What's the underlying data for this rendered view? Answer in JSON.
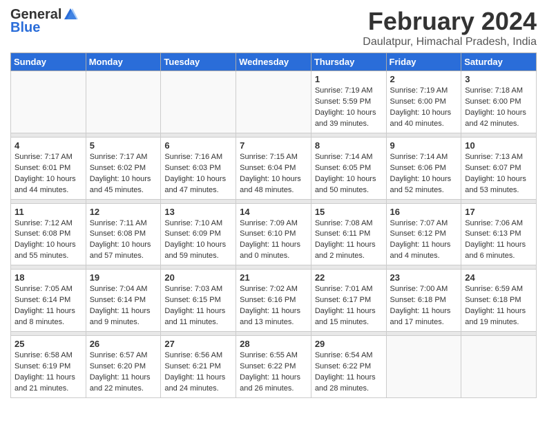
{
  "logo": {
    "general": "General",
    "blue": "Blue"
  },
  "title": "February 2024",
  "subtitle": "Daulatpur, Himachal Pradesh, India",
  "days_of_week": [
    "Sunday",
    "Monday",
    "Tuesday",
    "Wednesday",
    "Thursday",
    "Friday",
    "Saturday"
  ],
  "weeks": [
    [
      {
        "date": "",
        "info": ""
      },
      {
        "date": "",
        "info": ""
      },
      {
        "date": "",
        "info": ""
      },
      {
        "date": "",
        "info": ""
      },
      {
        "date": "1",
        "info": "Sunrise: 7:19 AM\nSunset: 5:59 PM\nDaylight: 10 hours\nand 39 minutes."
      },
      {
        "date": "2",
        "info": "Sunrise: 7:19 AM\nSunset: 6:00 PM\nDaylight: 10 hours\nand 40 minutes."
      },
      {
        "date": "3",
        "info": "Sunrise: 7:18 AM\nSunset: 6:00 PM\nDaylight: 10 hours\nand 42 minutes."
      }
    ],
    [
      {
        "date": "4",
        "info": "Sunrise: 7:17 AM\nSunset: 6:01 PM\nDaylight: 10 hours\nand 44 minutes."
      },
      {
        "date": "5",
        "info": "Sunrise: 7:17 AM\nSunset: 6:02 PM\nDaylight: 10 hours\nand 45 minutes."
      },
      {
        "date": "6",
        "info": "Sunrise: 7:16 AM\nSunset: 6:03 PM\nDaylight: 10 hours\nand 47 minutes."
      },
      {
        "date": "7",
        "info": "Sunrise: 7:15 AM\nSunset: 6:04 PM\nDaylight: 10 hours\nand 48 minutes."
      },
      {
        "date": "8",
        "info": "Sunrise: 7:14 AM\nSunset: 6:05 PM\nDaylight: 10 hours\nand 50 minutes."
      },
      {
        "date": "9",
        "info": "Sunrise: 7:14 AM\nSunset: 6:06 PM\nDaylight: 10 hours\nand 52 minutes."
      },
      {
        "date": "10",
        "info": "Sunrise: 7:13 AM\nSunset: 6:07 PM\nDaylight: 10 hours\nand 53 minutes."
      }
    ],
    [
      {
        "date": "11",
        "info": "Sunrise: 7:12 AM\nSunset: 6:08 PM\nDaylight: 10 hours\nand 55 minutes."
      },
      {
        "date": "12",
        "info": "Sunrise: 7:11 AM\nSunset: 6:08 PM\nDaylight: 10 hours\nand 57 minutes."
      },
      {
        "date": "13",
        "info": "Sunrise: 7:10 AM\nSunset: 6:09 PM\nDaylight: 10 hours\nand 59 minutes."
      },
      {
        "date": "14",
        "info": "Sunrise: 7:09 AM\nSunset: 6:10 PM\nDaylight: 11 hours\nand 0 minutes."
      },
      {
        "date": "15",
        "info": "Sunrise: 7:08 AM\nSunset: 6:11 PM\nDaylight: 11 hours\nand 2 minutes."
      },
      {
        "date": "16",
        "info": "Sunrise: 7:07 AM\nSunset: 6:12 PM\nDaylight: 11 hours\nand 4 minutes."
      },
      {
        "date": "17",
        "info": "Sunrise: 7:06 AM\nSunset: 6:13 PM\nDaylight: 11 hours\nand 6 minutes."
      }
    ],
    [
      {
        "date": "18",
        "info": "Sunrise: 7:05 AM\nSunset: 6:14 PM\nDaylight: 11 hours\nand 8 minutes."
      },
      {
        "date": "19",
        "info": "Sunrise: 7:04 AM\nSunset: 6:14 PM\nDaylight: 11 hours\nand 9 minutes."
      },
      {
        "date": "20",
        "info": "Sunrise: 7:03 AM\nSunset: 6:15 PM\nDaylight: 11 hours\nand 11 minutes."
      },
      {
        "date": "21",
        "info": "Sunrise: 7:02 AM\nSunset: 6:16 PM\nDaylight: 11 hours\nand 13 minutes."
      },
      {
        "date": "22",
        "info": "Sunrise: 7:01 AM\nSunset: 6:17 PM\nDaylight: 11 hours\nand 15 minutes."
      },
      {
        "date": "23",
        "info": "Sunrise: 7:00 AM\nSunset: 6:18 PM\nDaylight: 11 hours\nand 17 minutes."
      },
      {
        "date": "24",
        "info": "Sunrise: 6:59 AM\nSunset: 6:18 PM\nDaylight: 11 hours\nand 19 minutes."
      }
    ],
    [
      {
        "date": "25",
        "info": "Sunrise: 6:58 AM\nSunset: 6:19 PM\nDaylight: 11 hours\nand 21 minutes."
      },
      {
        "date": "26",
        "info": "Sunrise: 6:57 AM\nSunset: 6:20 PM\nDaylight: 11 hours\nand 22 minutes."
      },
      {
        "date": "27",
        "info": "Sunrise: 6:56 AM\nSunset: 6:21 PM\nDaylight: 11 hours\nand 24 minutes."
      },
      {
        "date": "28",
        "info": "Sunrise: 6:55 AM\nSunset: 6:22 PM\nDaylight: 11 hours\nand 26 minutes."
      },
      {
        "date": "29",
        "info": "Sunrise: 6:54 AM\nSunset: 6:22 PM\nDaylight: 11 hours\nand 28 minutes."
      },
      {
        "date": "",
        "info": ""
      },
      {
        "date": "",
        "info": ""
      }
    ]
  ]
}
